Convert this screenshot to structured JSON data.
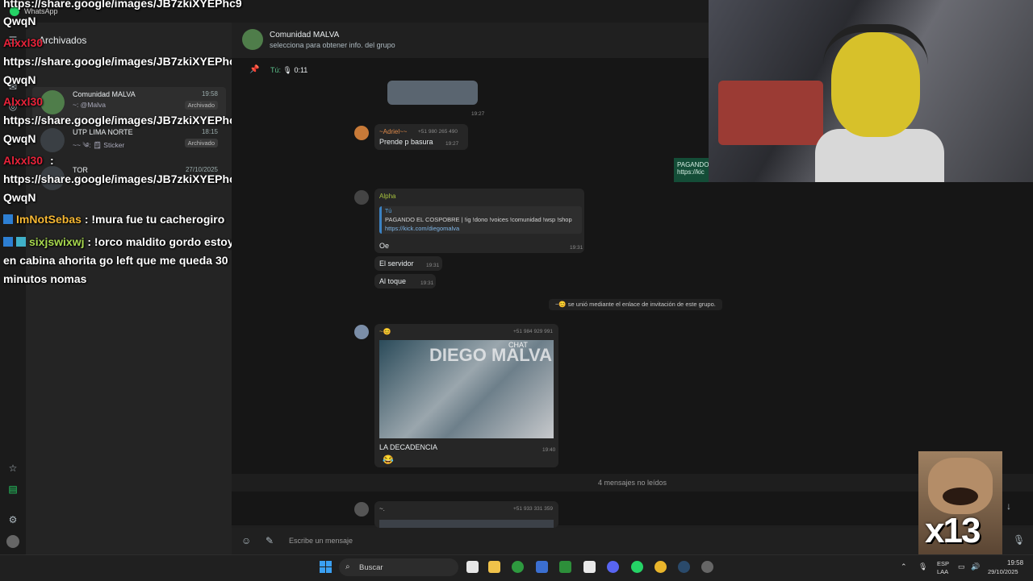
{
  "window": {
    "app_name": "WhatsApp"
  },
  "rail": {
    "icons": [
      "menu-icon",
      "chat-icon",
      "status-icon",
      "starred-icon",
      "archive-icon",
      "settings-icon",
      "profile-icon"
    ]
  },
  "list": {
    "header": "Archivados",
    "rows": [
      {
        "name": "Comunidad MALVA",
        "time": "19:58",
        "preview": "~: @Malva",
        "badge": "Archivado"
      },
      {
        "name": "UTP LIMA NORTE",
        "time": "18:15",
        "preview": "~~ ༄: 🗒 Sticker",
        "badge": "Archivado"
      },
      {
        "name": "TOR",
        "time": "27/10/2025",
        "preview": "",
        "badge": ""
      }
    ]
  },
  "overlay": {
    "line1": "https://share.google/images/JB7zkiXYEPhc9",
    "line1b": "QwqN",
    "user_a": "Alxxl30",
    "colon": ":",
    "line2": "https://share.google/images/JB7zkiXYEPhc9",
    "line2b": "QwqN",
    "line3": "https://share.google/images/JB7zkiXYEPhc9",
    "line3b": "QwqN",
    "line4": "https://share.google/images/JB7zkiXYEPhc9",
    "line4b": "QwqN",
    "user_b": "ImNotSebas",
    "msg_b": ": !mura fue tu cacherogiro",
    "user_c": "sixjswixwj",
    "msg_c1": ": !orco maldito gordo estoy",
    "msg_c2": "en cabina ahorita go left que me queda 30",
    "msg_c3": "minutos nomas"
  },
  "chat": {
    "group_name": "Comunidad MALVA",
    "group_sub": "selecciona para obtener info. del grupo",
    "pinned_me": "Tú:",
    "pinned_dur": "🎙 0:11",
    "img_time": "19:27",
    "m1_sender": "~Adriel~~",
    "m1_phone": "+51 980 265 490",
    "m1_text": "Prende p basura",
    "m1_time": "19:27",
    "m2_sender": "Alpha",
    "quote_who": "Tú",
    "quote_text": "PAGANDO EL COSPOBRE | !ig !dono !voices !comunidad !wsp !shop",
    "quote_link": "https://kick.com/diegomalva",
    "m2_text": "Oe",
    "m2_time": "19:31",
    "m3_text": "El servidor",
    "m3_time": "19:31",
    "m4_text": "Al toque",
    "m4_time": "19:31",
    "system_notice": "~😊 se unió mediante el enlace de invitación de este grupo.",
    "m5_sender": "~😊",
    "m5_phone": "+51 984 929 991",
    "media_text": "DIEGO MALVA",
    "media_chat": "CHAT",
    "m5_caption": "LA DECADENCIA",
    "m5_time": "19:40",
    "m5_reaction": "😂",
    "unread": "4 mensajes no leídos",
    "m6_sender": "~.",
    "m6_phone": "+51 933 331 359",
    "input_placeholder": "Escribe un mensaje",
    "peek_text1": "PAGANDO",
    "peek_text2": "https://kic"
  },
  "meme": {
    "text": "x13"
  },
  "taskbar": {
    "search": "Buscar",
    "lang1": "ESP",
    "lang2": "LAA",
    "time": "19:58",
    "date": "29/10/2025"
  },
  "colors": {
    "accent": "#25d366",
    "overlay_red": "#e8233a",
    "overlay_green": "#a7d84e",
    "overlay_yellow": "#f5b733"
  }
}
